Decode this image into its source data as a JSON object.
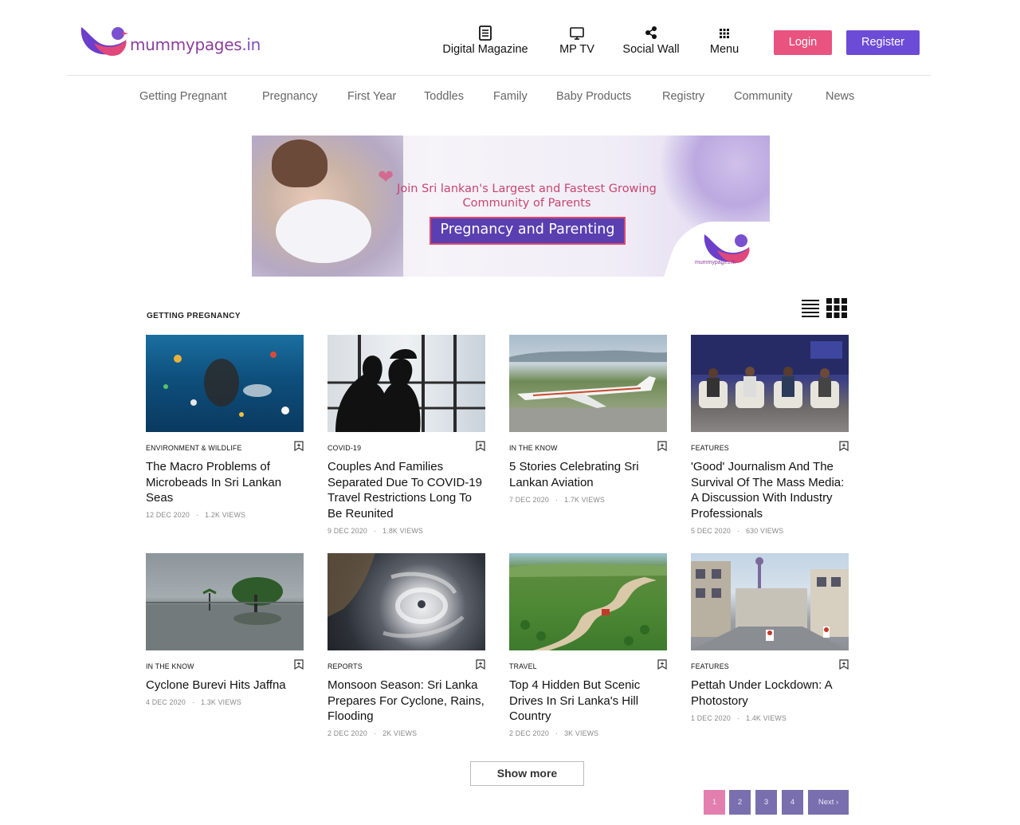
{
  "header": {
    "logo_text": "mummypages",
    "logo_tld": ".in",
    "nav": [
      {
        "label": "Digital Magazine",
        "icon": "document-icon"
      },
      {
        "label": "MP TV",
        "icon": "monitor-icon"
      },
      {
        "label": "Social Wall",
        "icon": "share-icon"
      },
      {
        "label": "Menu",
        "icon": "grid-menu-icon"
      }
    ],
    "login_label": "Login",
    "register_label": "Register"
  },
  "categories": [
    "Getting Pregnant",
    "Pregnancy",
    "First Year",
    "Toddles",
    "Family",
    "Baby Products",
    "Registry",
    "Community",
    "News"
  ],
  "banner": {
    "tagline_line1": "Join Sri lankan's Largest and Fastest Growing",
    "tagline_line2": "Community of Parents",
    "box_title": "Pregnancy and Parenting",
    "corner_logo_text": "mummypages.lk"
  },
  "section": {
    "title": "GETTING PREGNANCY"
  },
  "articles": [
    {
      "category": "ENVIRONMENT & WILDLIFE",
      "title": "The Macro Problems of Microbeads In Sri Lankan Seas",
      "date": "12 DEC 2020",
      "views": "1.2K VIEWS",
      "image": "underwater-pollution"
    },
    {
      "category": "COVID-19",
      "title": "Couples And Families Separated Due To COVID-19 Travel Restrictions Long To Be Reunited",
      "date": "9 DEC 2020",
      "views": "1.8K VIEWS",
      "image": "couple-silhouette"
    },
    {
      "category": "IN THE KNOW",
      "title": "5 Stories Celebrating Sri Lankan Aviation",
      "date": "7 DEC 2020",
      "views": "1.7K VIEWS",
      "image": "airplane-runway"
    },
    {
      "category": "FEATURES",
      "title": "'Good' Journalism And The Survival Of The Mass Media: A Discussion With Industry Professionals",
      "date": "5 DEC 2020",
      "views": "630 VIEWS",
      "image": "panel-discussion"
    },
    {
      "category": "IN THE KNOW",
      "title": "Cyclone Burevi Hits Jaffna",
      "date": "4 DEC 2020",
      "views": "1.3K VIEWS",
      "image": "flooded-trees"
    },
    {
      "category": "REPORTS",
      "title": "Monsoon Season: Sri Lanka Prepares For Cyclone, Rains, Flooding",
      "date": "2 DEC 2020",
      "views": "2K VIEWS",
      "image": "cyclone-satellite"
    },
    {
      "category": "TRAVEL",
      "title": "Top 4 Hidden But Scenic Drives In Sri Lanka's Hill Country",
      "date": "2 DEC 2020",
      "views": "3K VIEWS",
      "image": "tea-hill-road"
    },
    {
      "category": "FEATURES",
      "title": "Pettah Under Lockdown: A Photostory",
      "date": "1 DEC 2020",
      "views": "1.4K VIEWS",
      "image": "empty-street"
    }
  ],
  "show_more_label": "Show more",
  "pagination": {
    "pages": [
      "1",
      "2",
      "3",
      "4"
    ],
    "current": "1",
    "next_label": "Next ›"
  },
  "colors": {
    "login": "#e8537f",
    "register": "#6c4bd6",
    "page_active": "#e37fae",
    "page": "#7a6fae"
  }
}
